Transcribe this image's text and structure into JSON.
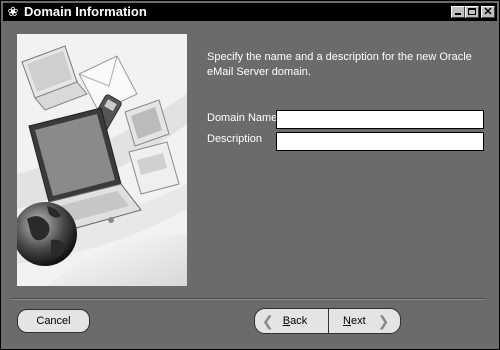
{
  "window": {
    "title": "Domain Information",
    "icon": "oracle-globe-icon"
  },
  "main": {
    "instructions": "Specify the name and a description for the new Oracle eMail Server domain.",
    "fields": {
      "domain_name_label": "Domain Name",
      "domain_name_value": "",
      "description_label": "Description",
      "description_value": ""
    }
  },
  "buttons": {
    "cancel": "Cancel",
    "back": "Back",
    "next": "Next"
  },
  "colors": {
    "background": "#6b6b6b",
    "titlebar": "#000000",
    "button": "#e4e4e4"
  }
}
